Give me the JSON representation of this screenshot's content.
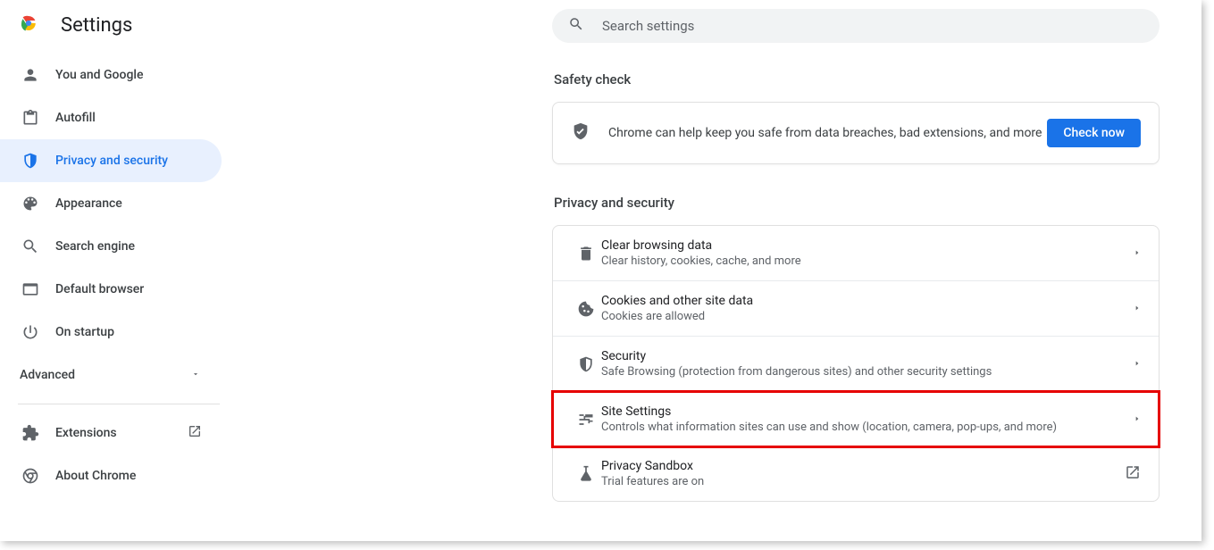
{
  "header": {
    "title": "Settings"
  },
  "search": {
    "placeholder": "Search settings"
  },
  "sidebar": {
    "items": [
      {
        "label": "You and Google"
      },
      {
        "label": "Autofill"
      },
      {
        "label": "Privacy and security"
      },
      {
        "label": "Appearance"
      },
      {
        "label": "Search engine"
      },
      {
        "label": "Default browser"
      },
      {
        "label": "On startup"
      }
    ],
    "advanced": "Advanced",
    "extensions": "Extensions",
    "about": "About Chrome"
  },
  "content": {
    "safety": {
      "title": "Safety check",
      "text": "Chrome can help keep you safe from data breaches, bad extensions, and more",
      "button": "Check now"
    },
    "privacy": {
      "title": "Privacy and security",
      "rows": [
        {
          "title": "Clear browsing data",
          "desc": "Clear history, cookies, cache, and more"
        },
        {
          "title": "Cookies and other site data",
          "desc": "Cookies are allowed"
        },
        {
          "title": "Security",
          "desc": "Safe Browsing (protection from dangerous sites) and other security settings"
        },
        {
          "title": "Site Settings",
          "desc": "Controls what information sites can use and show (location, camera, pop-ups, and more)"
        },
        {
          "title": "Privacy Sandbox",
          "desc": "Trial features are on"
        }
      ]
    }
  }
}
